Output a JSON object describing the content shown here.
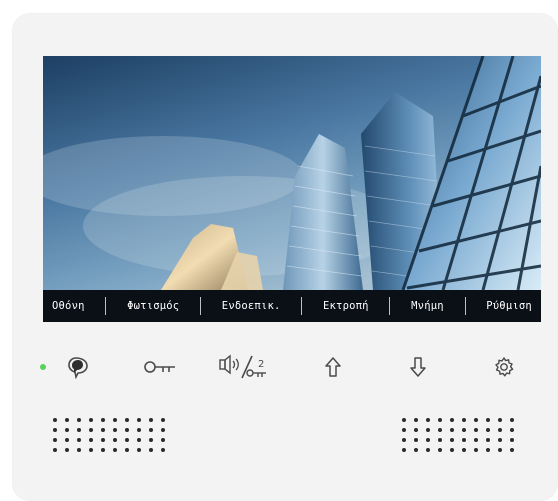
{
  "device": {
    "menu": {
      "items": [
        {
          "label": "Οθόνη"
        },
        {
          "label": "Φωτισμός"
        },
        {
          "label": "Ενδοεπικ."
        },
        {
          "label": "Εκτροπή"
        },
        {
          "label": "Μνήμη"
        },
        {
          "label": "Ρύθμιση"
        }
      ]
    },
    "buttons": [
      {
        "icon": "talk-icon"
      },
      {
        "icon": "key-icon"
      },
      {
        "icon": "volume-unlock-2-icon",
        "number": "2"
      },
      {
        "icon": "arrow-up-icon"
      },
      {
        "icon": "arrow-down-icon"
      },
      {
        "icon": "gear-icon"
      }
    ],
    "colors": {
      "indicator": "#5ad15a",
      "body": "#f3f3f4",
      "menu_bar": "#0b0f16",
      "icon": "#4a4a4a"
    }
  }
}
